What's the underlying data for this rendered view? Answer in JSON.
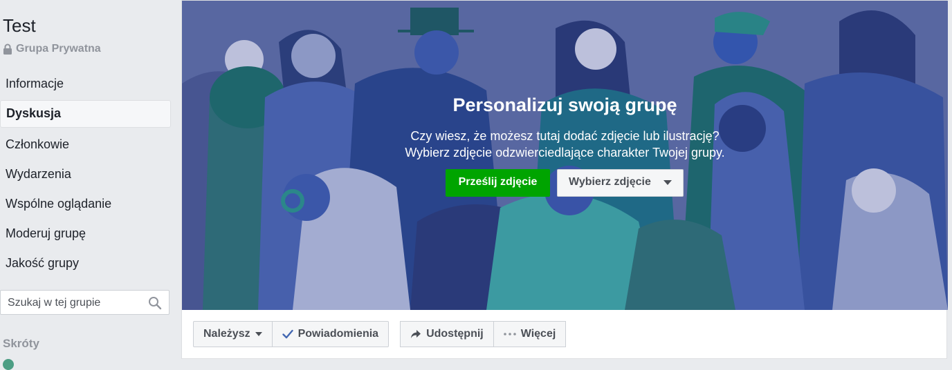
{
  "group": {
    "name": "Test",
    "privacy": "Grupa Prywatna"
  },
  "sidebar": {
    "items": [
      {
        "label": "Informacje",
        "active": false
      },
      {
        "label": "Dyskusja",
        "active": true
      },
      {
        "label": "Członkowie",
        "active": false
      },
      {
        "label": "Wydarzenia",
        "active": false
      },
      {
        "label": "Wspólne oglądanie",
        "active": false
      },
      {
        "label": "Moderuj grupę",
        "active": false
      },
      {
        "label": "Jakość grupy",
        "active": false
      }
    ],
    "search_placeholder": "Szukaj w tej grupie",
    "shortcuts_label": "Skróty"
  },
  "cover": {
    "title": "Personalizuj swoją grupę",
    "description_line1": "Czy wiesz, że możesz tutaj dodać zdjęcie lub ilustrację?",
    "description_line2": "Wybierz zdjęcie odzwierciedlające charakter Twojej grupy.",
    "upload_label": "Prześlij zdjęcie",
    "choose_label": "Wybierz zdjęcie"
  },
  "actions": {
    "member_label": "Należysz",
    "notifications_label": "Powiadomienia",
    "share_label": "Udostępnij",
    "more_label": "Więcej"
  },
  "colors": {
    "upload_green": "#00a400",
    "cover_blue": "#5a6aa6",
    "check_blue": "#4267b2"
  }
}
